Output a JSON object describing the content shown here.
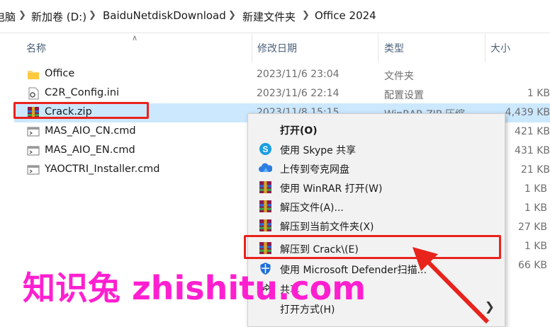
{
  "breadcrumb": [
    "电脑",
    "新加卷 (D:)",
    "BaiduNetdiskDownload",
    "新建文件夹",
    "Office 2024"
  ],
  "columns": {
    "name": "名称",
    "date": "修改日期",
    "type": "类型",
    "size": "大小"
  },
  "files": [
    {
      "name": "Office",
      "date": "2023/11/6 23:04",
      "type": "文件夹",
      "size": "",
      "icon": "folder-icon"
    },
    {
      "name": "C2R_Config.ini",
      "date": "2023/11/6 22:14",
      "type": "配置设置",
      "size": "1 KB",
      "icon": "ini-file-icon"
    },
    {
      "name": "Crack.zip",
      "date": "2023/11/8 15:15",
      "type": "WinRAR ZIP 压缩",
      "size": "4,439 KB",
      "icon": "winrar-icon"
    },
    {
      "name": "MAS_AIO_CN.cmd",
      "date": "",
      "type": "",
      "size": "421 KB",
      "icon": "cmd-file-icon"
    },
    {
      "name": "MAS_AIO_EN.cmd",
      "date": "",
      "type": "",
      "size": "431 KB",
      "icon": "cmd-file-icon"
    },
    {
      "name": "YAOCTRI_Installer.cmd",
      "date": "",
      "type": "",
      "size": "21 KB",
      "icon": "cmd-file-icon"
    }
  ],
  "extra_sizes": [
    "1 KB",
    "1 KB",
    "27 KB",
    "1 KB",
    "66 KB"
  ],
  "context_menu": [
    {
      "label": "打开(O)",
      "icon": "",
      "bold": true
    },
    {
      "label": "使用 Skype 共享",
      "icon": "skype-icon"
    },
    {
      "label": "上传到夸克网盘",
      "icon": "cloud-icon"
    },
    {
      "label": "使用 WinRAR 打开(W)",
      "icon": "winrar-icon"
    },
    {
      "label": "解压文件(A)...",
      "icon": "winrar-icon"
    },
    {
      "label": "解压到当前文件夹(X)",
      "icon": "winrar-icon"
    },
    {
      "label": "解压到 Crack\\(E)",
      "icon": "winrar-icon"
    },
    {
      "label": "使用 Microsoft Defender扫描...",
      "icon": "defender-icon"
    },
    {
      "label": "共享",
      "icon": "share-icon"
    },
    {
      "label": "打开方式(H)",
      "icon": "",
      "submenu": true
    }
  ],
  "watermark": "知识兔 zhishitu.com",
  "colors": {
    "selection": "#cce8ff",
    "highlight_box": "#e8231c",
    "watermark": "#ff1fd0",
    "arrow": "#e8231c"
  }
}
